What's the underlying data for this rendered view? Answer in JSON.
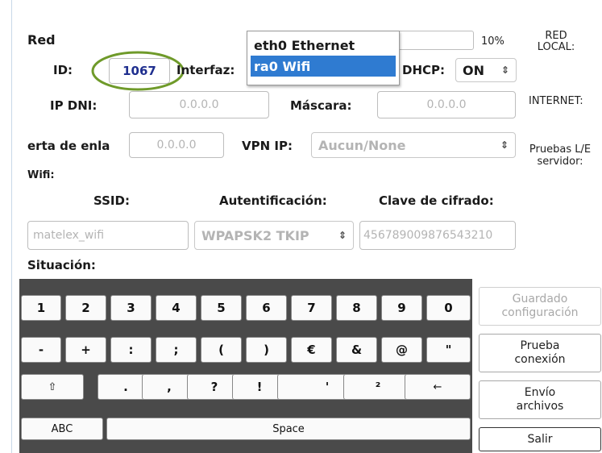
{
  "network": {
    "section_title": "Red",
    "id_label": "ID:",
    "id_value": "1067",
    "interface_label": "Interfaz:",
    "interface_options": [
      "eth0 Ethernet",
      "ra0  Wifi"
    ],
    "progress_label": "10%",
    "progress_fraction": 0.1,
    "dhcp_label": "DHCP:",
    "dhcp_value": "ON",
    "ip_label": "IP DNI:",
    "ip_value": "0.0.0.0",
    "mask_label": "Máscara:",
    "mask_value": "0.0.0.0",
    "gateway_label": "erta de enla",
    "gateway_value": "0.0.0.0",
    "vpn_label": "VPN IP:",
    "vpn_value": "Aucun/None"
  },
  "status": {
    "local_label": "RED\nLOCAL:",
    "internet_label": "INTERNET:",
    "test_label": "Pruebas L/E\nservidor:"
  },
  "wifi": {
    "section_title": "Wifi:",
    "ssid_label": "SSID:",
    "auth_label": "Autentificación:",
    "key_label": "Clave de cifrado:",
    "ssid_value": "matelex_wifi",
    "auth_value": "WPAPSK2 TKIP",
    "key_value": "456789009876543210",
    "situation_label": "Situación:"
  },
  "keyboard": {
    "row1": [
      "1",
      "2",
      "3",
      "4",
      "5",
      "6",
      "7",
      "8",
      "9",
      "0"
    ],
    "row2": [
      "-",
      "+",
      ":",
      ";",
      "(",
      ")",
      "€",
      "&",
      "@",
      "\""
    ],
    "row3": [
      "⇧",
      ".",
      ",",
      "?",
      "!",
      "'",
      "²",
      "←"
    ],
    "abc": "ABC",
    "space": "Space"
  },
  "actions": {
    "save": "Guardado\nconfiguración",
    "test": "Prueba\nconexión",
    "send": "Envío\narchivos",
    "exit": "Salir"
  },
  "colors": {
    "accent": "#2f7bd1",
    "highlight_circle": "#6f9a2a",
    "id_text": "#1f2f8f"
  }
}
